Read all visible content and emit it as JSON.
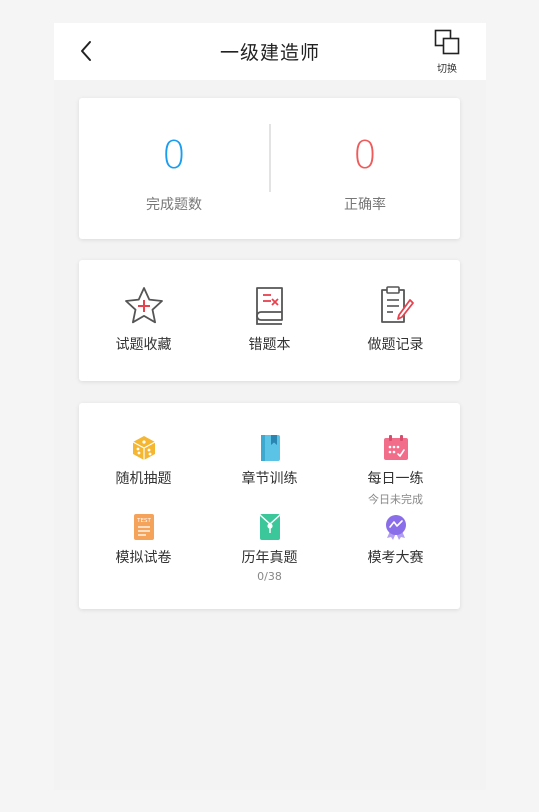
{
  "header": {
    "title": "一级建造师",
    "switch_label": "切换"
  },
  "stats": {
    "completed": {
      "value": "0",
      "label": "完成题数",
      "color": "#1a9df0"
    },
    "accuracy": {
      "value": "0",
      "label": "正确率",
      "color": "#f05a5a"
    }
  },
  "tools": [
    {
      "label": "试题收藏",
      "icon": "star-icon"
    },
    {
      "label": "错题本",
      "icon": "error-book-icon"
    },
    {
      "label": "做题记录",
      "icon": "record-icon"
    }
  ],
  "modes": [
    {
      "label": "随机抽题",
      "icon": "dice-icon",
      "sub": ""
    },
    {
      "label": "章节训练",
      "icon": "book-icon",
      "sub": ""
    },
    {
      "label": "每日一练",
      "icon": "calendar-icon",
      "sub": "今日未完成"
    },
    {
      "label": "模拟试卷",
      "icon": "test-paper-icon",
      "sub": ""
    },
    {
      "label": "历年真题",
      "icon": "envelope-icon",
      "sub": "0/38"
    },
    {
      "label": "模考大赛",
      "icon": "medal-icon",
      "sub": ""
    }
  ],
  "colors": {
    "accent_blue": "#1a9df0",
    "accent_red": "#f05a5a",
    "icon_yellow": "#f5b731",
    "icon_cyan": "#5bc3e6",
    "icon_pink": "#f26d8a",
    "icon_orange": "#f5a25b",
    "icon_green": "#3cc79a",
    "icon_purple": "#8a6de8"
  }
}
